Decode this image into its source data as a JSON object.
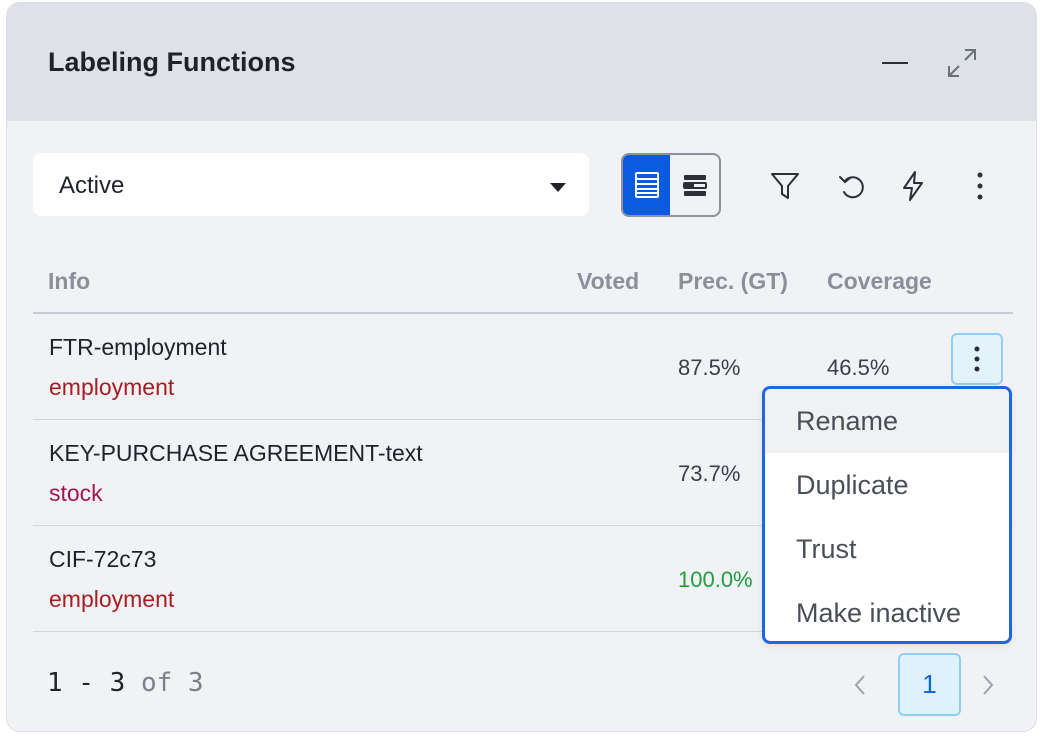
{
  "panel": {
    "title": "Labeling Functions",
    "header_icons": [
      "minimize-icon",
      "expand-icon"
    ]
  },
  "toolbar": {
    "filter_select_value": "Active",
    "view_modes": [
      "table-view-icon",
      "card-view-icon"
    ],
    "active_view": "table-view-icon",
    "actions": [
      "filter-icon",
      "refresh-icon",
      "lightning-icon",
      "more-vertical-icon"
    ]
  },
  "table": {
    "columns": {
      "info": "Info",
      "voted": "Voted",
      "precision": "Prec. (GT)",
      "coverage": "Coverage"
    },
    "rows": [
      {
        "name": "FTR-employment",
        "label": "employment",
        "label_color": "#a61e22",
        "voted": "",
        "precision": "87.5%",
        "precision_color": "#3a3f47",
        "coverage": "46.5%"
      },
      {
        "name": "KEY-PURCHASE AGREEMENT-text",
        "label": "stock",
        "label_color": "#a0174f",
        "voted": "",
        "precision": "73.7%",
        "precision_color": "#3a3f47",
        "coverage": ""
      },
      {
        "name": "CIF-72c73",
        "label": "employment",
        "label_color": "#a61e22",
        "voted": "",
        "precision": "100.0%",
        "precision_color": "#1f9d3f",
        "coverage": ""
      }
    ]
  },
  "context_menu": {
    "items": [
      "Rename",
      "Duplicate",
      "Trust",
      "Make inactive"
    ],
    "highlighted": "Rename"
  },
  "pagination": {
    "range": "1 - 3",
    "of_text": "of 3",
    "current_page": "1"
  },
  "colors": {
    "accent": "#0b5be0",
    "header_bg": "#dfe1e9",
    "panel_bg": "#f1f2f6",
    "menu_border": "#1f66e0",
    "selected_btn_bg": "#dff1fb"
  }
}
